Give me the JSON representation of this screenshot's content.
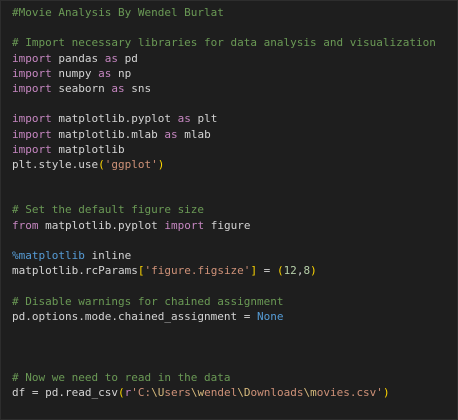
{
  "editor": {
    "language": "python",
    "colors": {
      "background": "#1e1e1e",
      "comment": "#6a9955",
      "keyword": "#c586c0",
      "plain": "#d4d4d4",
      "string": "#ce9178",
      "number": "#b5cea8",
      "constant": "#569cd6",
      "bracket": "#ffd700"
    },
    "lines": [
      [
        {
          "t": "comment",
          "v": "#Movie Analysis By Wendel Burlat"
        }
      ],
      [],
      [
        {
          "t": "comment",
          "v": "# Import necessary libraries for data analysis and visualization"
        }
      ],
      [
        {
          "t": "keyword",
          "v": "import"
        },
        {
          "t": "plain",
          "v": " pandas "
        },
        {
          "t": "keyword",
          "v": "as"
        },
        {
          "t": "plain",
          "v": " pd"
        }
      ],
      [
        {
          "t": "keyword",
          "v": "import"
        },
        {
          "t": "plain",
          "v": " numpy "
        },
        {
          "t": "keyword",
          "v": "as"
        },
        {
          "t": "plain",
          "v": " np"
        }
      ],
      [
        {
          "t": "keyword",
          "v": "import"
        },
        {
          "t": "plain",
          "v": " seaborn "
        },
        {
          "t": "keyword",
          "v": "as"
        },
        {
          "t": "plain",
          "v": " sns"
        }
      ],
      [],
      [
        {
          "t": "keyword",
          "v": "import"
        },
        {
          "t": "plain",
          "v": " matplotlib.pyplot "
        },
        {
          "t": "keyword",
          "v": "as"
        },
        {
          "t": "plain",
          "v": " plt"
        }
      ],
      [
        {
          "t": "keyword",
          "v": "import"
        },
        {
          "t": "plain",
          "v": " matplotlib.mlab "
        },
        {
          "t": "keyword",
          "v": "as"
        },
        {
          "t": "plain",
          "v": " mlab"
        }
      ],
      [
        {
          "t": "keyword",
          "v": "import"
        },
        {
          "t": "plain",
          "v": " matplotlib"
        }
      ],
      [
        {
          "t": "plain",
          "v": "plt.style.use"
        },
        {
          "t": "bracket",
          "v": "("
        },
        {
          "t": "string",
          "v": "'ggplot'"
        },
        {
          "t": "bracket",
          "v": ")"
        }
      ],
      [],
      [],
      [
        {
          "t": "comment",
          "v": "# Set the default figure size"
        }
      ],
      [
        {
          "t": "keyword",
          "v": "from"
        },
        {
          "t": "plain",
          "v": " matplotlib.pyplot "
        },
        {
          "t": "keyword",
          "v": "import"
        },
        {
          "t": "plain",
          "v": " figure"
        }
      ],
      [],
      [
        {
          "t": "magic",
          "v": "%matplotlib"
        },
        {
          "t": "plain",
          "v": " inline"
        }
      ],
      [
        {
          "t": "plain",
          "v": "matplotlib.rcParams"
        },
        {
          "t": "bracket",
          "v": "["
        },
        {
          "t": "string",
          "v": "'figure.figsize'"
        },
        {
          "t": "bracket",
          "v": "]"
        },
        {
          "t": "plain",
          "v": " = "
        },
        {
          "t": "bracket",
          "v": "("
        },
        {
          "t": "number",
          "v": "12"
        },
        {
          "t": "plain",
          "v": ","
        },
        {
          "t": "number",
          "v": "8"
        },
        {
          "t": "bracket",
          "v": ")"
        }
      ],
      [],
      [
        {
          "t": "comment",
          "v": "# Disable warnings for chained assignment"
        }
      ],
      [
        {
          "t": "plain",
          "v": "pd.options.mode.chained_assignment = "
        },
        {
          "t": "const",
          "v": "None"
        }
      ],
      [],
      [],
      [],
      [
        {
          "t": "comment",
          "v": "# Now we need to read in the data"
        }
      ],
      [
        {
          "t": "plain",
          "v": "df = pd.read_csv"
        },
        {
          "t": "bracket",
          "v": "("
        },
        {
          "t": "keyword",
          "v": "r"
        },
        {
          "t": "string",
          "v": "'C:"
        },
        {
          "t": "escape",
          "v": "\\U"
        },
        {
          "t": "string",
          "v": "sers"
        },
        {
          "t": "escape",
          "v": "\\w"
        },
        {
          "t": "string",
          "v": "endel"
        },
        {
          "t": "escape",
          "v": "\\D"
        },
        {
          "t": "string",
          "v": "ownloads"
        },
        {
          "t": "escape",
          "v": "\\m"
        },
        {
          "t": "string",
          "v": "ovies.csv'"
        },
        {
          "t": "bracket",
          "v": ")"
        }
      ]
    ]
  }
}
